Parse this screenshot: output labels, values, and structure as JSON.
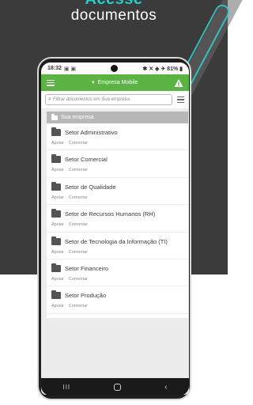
{
  "hero": {
    "accent": "Acesse",
    "title": "documentos"
  },
  "status_bar": {
    "time": "18:32",
    "left_icons": "▣ ▣",
    "right_text": "✱ ✕ ◈ ✈ 81% ▮"
  },
  "app_bar": {
    "company_label": "Empresa Mobile",
    "menu_icon": "hamburger-menu-icon",
    "alert_icon": "warning-triangle-icon",
    "accent_color": "#5ab342"
  },
  "search": {
    "placeholder": "Filtrar documentos em Sua empresa"
  },
  "panel": {
    "header": "Sua empresa",
    "items": [
      {
        "title": "Setor Administrativo",
        "action_1": "Apoiar",
        "action_2": "Comentar"
      },
      {
        "title": "Setor Comercial",
        "action_1": "Apoiar",
        "action_2": "Comentar"
      },
      {
        "title": "Setor de Qualidade",
        "action_1": "Apoiar",
        "action_2": "Comentar"
      },
      {
        "title": "Setor de Recursos Humanos (RH)",
        "action_1": "Apoiar",
        "action_2": "Comentar"
      },
      {
        "title": "Setor de Tecnologia da Informação (TI)",
        "action_1": "Apoiar",
        "action_2": "Comentar"
      },
      {
        "title": "Setor Financeiro",
        "action_1": "Apoiar",
        "action_2": "Comentar"
      },
      {
        "title": "Setor Produção",
        "action_1": "Apoiar",
        "action_2": "Comentar"
      }
    ]
  },
  "nav_bar": {
    "recents": "III",
    "back": "‹"
  },
  "colors": {
    "background_dark": "#3b3b3b",
    "hero_accent": "#22d1c8",
    "folder": "#545454"
  }
}
